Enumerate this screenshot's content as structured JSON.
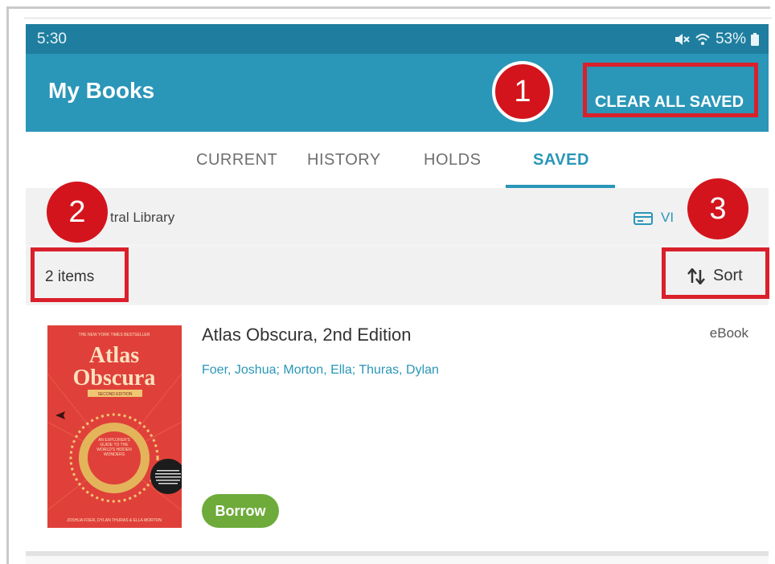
{
  "status_bar": {
    "time": "5:30",
    "battery": "53%"
  },
  "app_bar": {
    "title": "My Books",
    "clear_all_label": "CLEAR ALL SAVED"
  },
  "tabs": [
    {
      "label": "CURRENT",
      "active": false
    },
    {
      "label": "HISTORY",
      "active": false
    },
    {
      "label": "HOLDS",
      "active": false
    },
    {
      "label": "SAVED",
      "active": true
    }
  ],
  "library": {
    "name": "tral Library",
    "view_label": "VI"
  },
  "list_header": {
    "count": "2 items",
    "sort_label": "Sort"
  },
  "books": [
    {
      "title": "Atlas Obscura, 2nd Edition",
      "authors": "Foer, Joshua; Morton, Ella; Thuras, Dylan",
      "format": "eBook",
      "action": "Borrow",
      "cover": {
        "top_banner": "THE NEW YORK TIMES BESTSELLER",
        "title_line1": "Atlas",
        "title_line2": "Obscura",
        "ribbon": "SECOND EDITION",
        "subtitle": "AN EXPLORER'S GUIDE TO THE WORLD'S HIDDEN WONDERS",
        "byline": "JOSHUA FOER, DYLAN THURAS & ELLA MORTON"
      }
    }
  ],
  "annotations": {
    "badge_1": "1",
    "badge_2": "2",
    "badge_3": "3"
  },
  "colors": {
    "app_bar": "#2a96b8",
    "status_bar": "#1f7e9f",
    "borrow": "#6eab3a",
    "annotation": "#d3141c",
    "cover": "#e0403a"
  }
}
